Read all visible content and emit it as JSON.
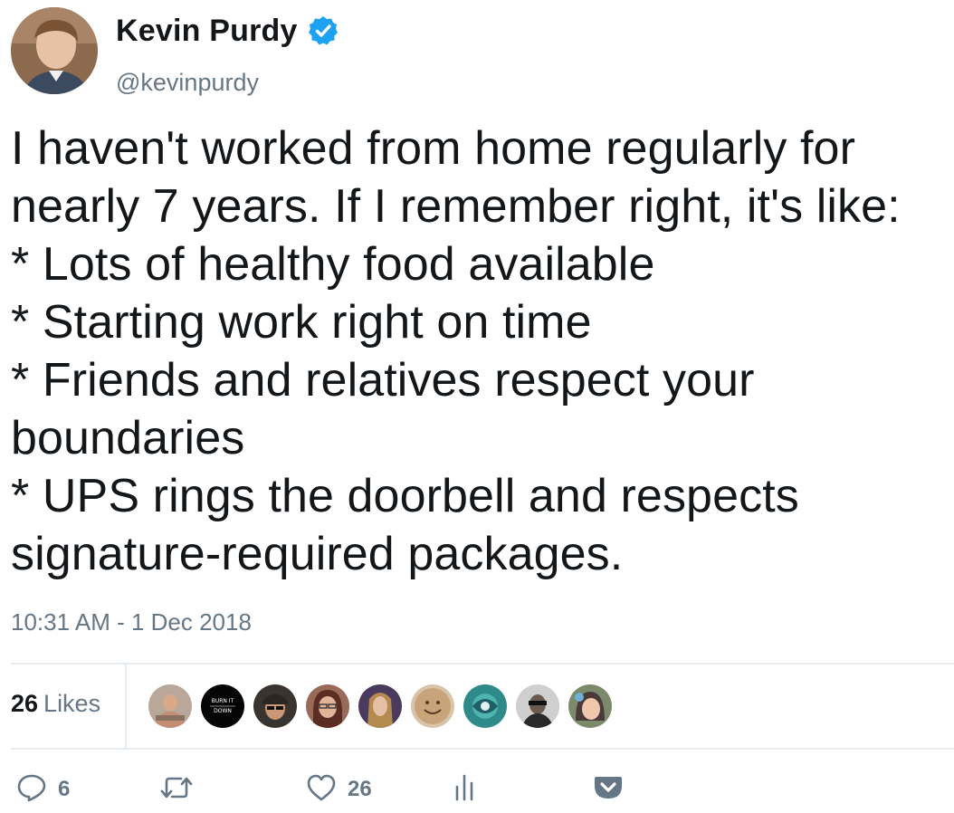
{
  "author": {
    "name": "Kevin Purdy",
    "handle": "@kevinpurdy",
    "verified": true,
    "avatar_icon": "profile-photo"
  },
  "tweet": {
    "text": "I haven't worked from home regularly for\nnearly 7 years. If I remember right, it's like:\n* Lots of healthy food available\n* Starting work right on time\n* Friends and relatives respect your\nboundaries\n* UPS rings the doorbell and respects\nsignature-required packages.",
    "timestamp": "10:31 AM - 1 Dec 2018"
  },
  "engagement": {
    "likes_count": "26",
    "likes_label": "Likes",
    "liker_avatars": [
      {
        "name": "liker-avatar-1"
      },
      {
        "name": "liker-avatar-2",
        "text_line1": "BURN IT",
        "text_line2": "DOWN"
      },
      {
        "name": "liker-avatar-3"
      },
      {
        "name": "liker-avatar-4"
      },
      {
        "name": "liker-avatar-5"
      },
      {
        "name": "liker-avatar-6"
      },
      {
        "name": "liker-avatar-7"
      },
      {
        "name": "liker-avatar-8"
      },
      {
        "name": "liker-avatar-9"
      }
    ]
  },
  "actions": {
    "reply_count": "6",
    "retweet_count": "",
    "like_count": "26",
    "icons": [
      "reply-icon",
      "retweet-icon",
      "heart-icon",
      "analytics-icon",
      "pocket-icon"
    ]
  },
  "colors": {
    "text": "#14171a",
    "secondary": "#657786",
    "verified_blue": "#1da1f2",
    "divider": "#e6ecf0"
  }
}
